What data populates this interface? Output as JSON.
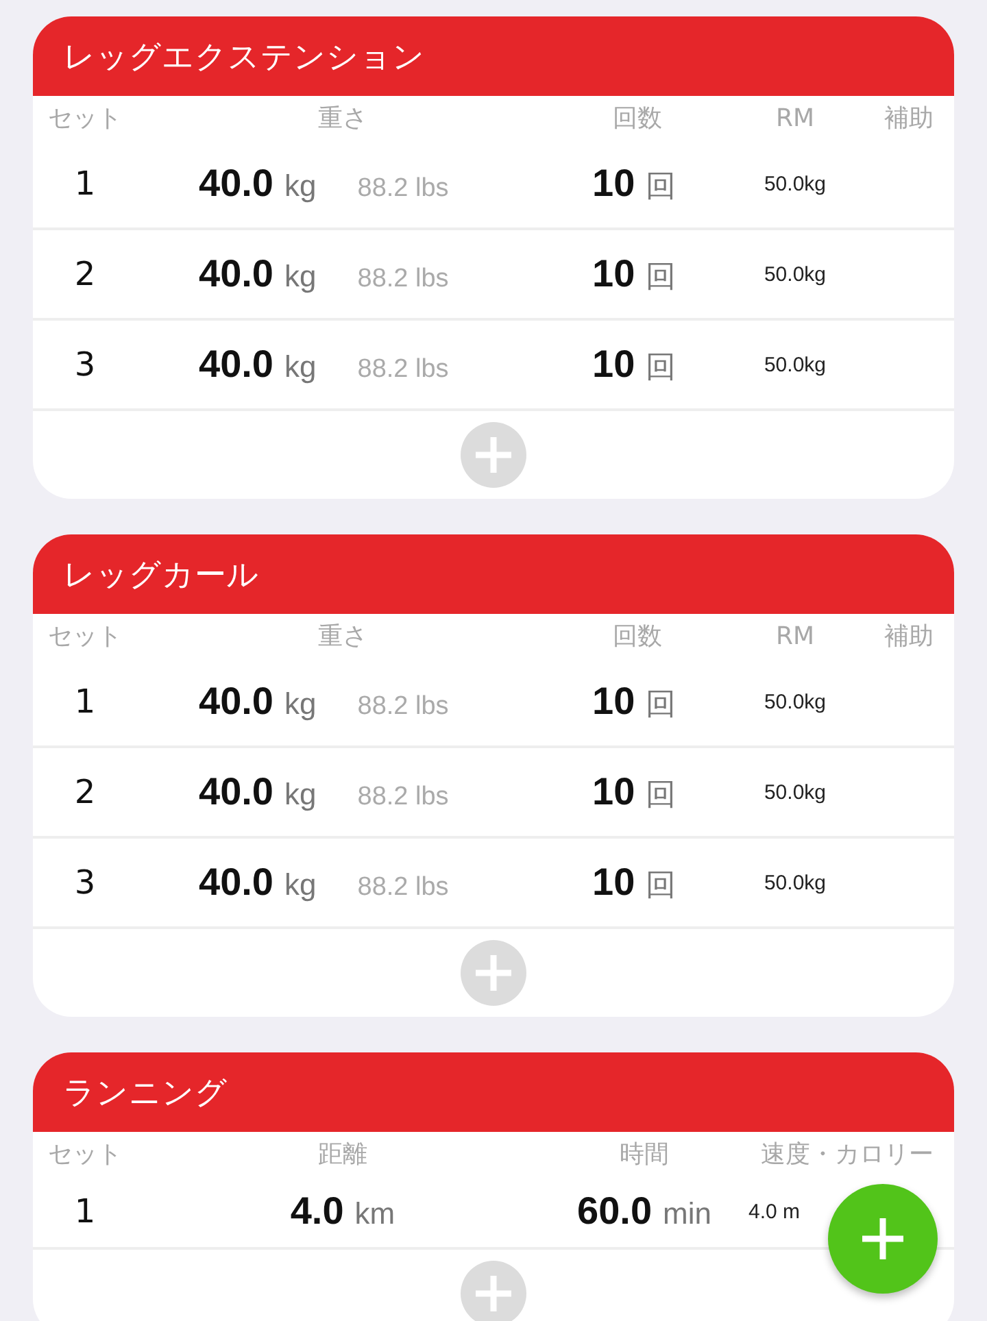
{
  "exercises": [
    {
      "title": "レッグエクステンション",
      "kind": "weight",
      "columns": [
        "セット",
        "重さ",
        "回数",
        "RM",
        "補助"
      ],
      "sets": [
        {
          "set": "1",
          "weight": "40.0",
          "weight_unit": "kg",
          "lbs": "88.2 lbs",
          "reps": "10",
          "reps_unit": "回",
          "rm": "50.0kg"
        },
        {
          "set": "2",
          "weight": "40.0",
          "weight_unit": "kg",
          "lbs": "88.2 lbs",
          "reps": "10",
          "reps_unit": "回",
          "rm": "50.0kg"
        },
        {
          "set": "3",
          "weight": "40.0",
          "weight_unit": "kg",
          "lbs": "88.2 lbs",
          "reps": "10",
          "reps_unit": "回",
          "rm": "50.0kg"
        }
      ]
    },
    {
      "title": "レッグカール",
      "kind": "weight",
      "columns": [
        "セット",
        "重さ",
        "回数",
        "RM",
        "補助"
      ],
      "sets": [
        {
          "set": "1",
          "weight": "40.0",
          "weight_unit": "kg",
          "lbs": "88.2 lbs",
          "reps": "10",
          "reps_unit": "回",
          "rm": "50.0kg"
        },
        {
          "set": "2",
          "weight": "40.0",
          "weight_unit": "kg",
          "lbs": "88.2 lbs",
          "reps": "10",
          "reps_unit": "回",
          "rm": "50.0kg"
        },
        {
          "set": "3",
          "weight": "40.0",
          "weight_unit": "kg",
          "lbs": "88.2 lbs",
          "reps": "10",
          "reps_unit": "回",
          "rm": "50.0kg"
        }
      ]
    },
    {
      "title": "ランニング",
      "kind": "cardio",
      "columns": [
        "セット",
        "距離",
        "時間",
        "速度・カロリー"
      ],
      "sets": [
        {
          "set": "1",
          "distance": "4.0",
          "distance_unit": "km",
          "time": "60.0",
          "time_unit": "min",
          "speed": "4.0 m"
        }
      ]
    }
  ]
}
